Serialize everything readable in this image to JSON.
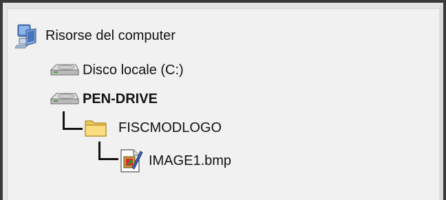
{
  "tree": {
    "root": {
      "label": "Risorse del computer",
      "icon": "my-computer-icon"
    },
    "drive_c": {
      "label": "Disco locale (C:)",
      "icon": "hard-drive-icon"
    },
    "pen_drive": {
      "label": "PEN-DRIVE",
      "icon": "removable-drive-icon"
    },
    "folder": {
      "label": "FISCMODLOGO",
      "icon": "folder-icon"
    },
    "file": {
      "label": "IMAGE1.bmp",
      "icon": "bitmap-file-icon"
    }
  }
}
